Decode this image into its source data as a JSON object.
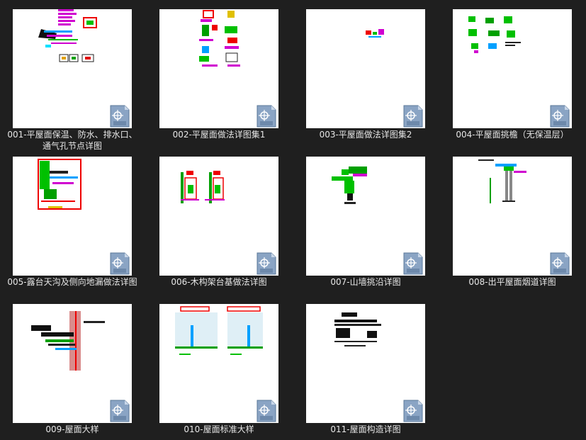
{
  "files": [
    {
      "name": "001-平屋面保温、防水、排水口、通气孔节点详图",
      "icon": "dwg-file-icon"
    },
    {
      "name": "002-平屋面做法详图集1",
      "icon": "dwg-file-icon"
    },
    {
      "name": "003-平屋面做法详图集2",
      "icon": "dwg-file-icon"
    },
    {
      "name": "004-平屋面挑檐（无保温层）",
      "icon": "dwg-file-icon"
    },
    {
      "name": "005-露台天沟及侧向地漏做法详图",
      "icon": "dwg-file-icon"
    },
    {
      "name": "006-木构架台基做法详图",
      "icon": "dwg-file-icon"
    },
    {
      "name": "007-山墙挑沿详图",
      "icon": "dwg-file-icon"
    },
    {
      "name": "008-出平屋面烟道详图",
      "icon": "dwg-file-icon"
    },
    {
      "name": "009-屋面大样",
      "icon": "dwg-file-icon"
    },
    {
      "name": "010-屋面标准大样",
      "icon": "dwg-file-icon"
    },
    {
      "name": "011-屋面构造详图",
      "icon": "dwg-file-icon"
    }
  ],
  "colors": {
    "background": "#1f1f1f",
    "caption_text": "#e6e6e6",
    "thumb_bg": "#ffffff"
  }
}
